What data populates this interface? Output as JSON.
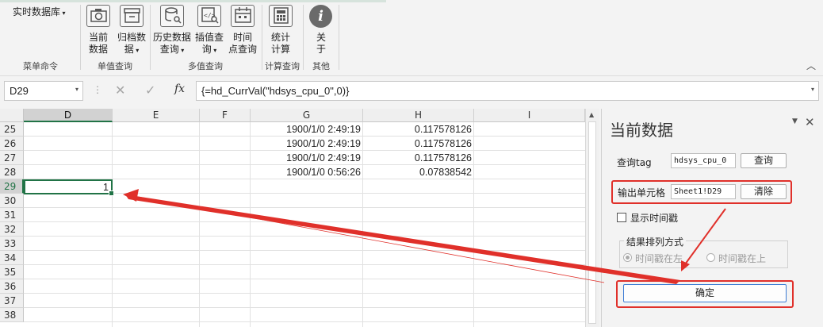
{
  "ribbon": {
    "menu_label": "实时数据库",
    "buttons": {
      "current": [
        "当前",
        "数据"
      ],
      "archive": [
        "归档数",
        "据"
      ],
      "history": [
        "历史数据",
        "查询"
      ],
      "interp": [
        "插值查",
        "询"
      ],
      "timepoint": [
        "时间",
        "点查询"
      ],
      "stats": [
        "统计",
        "计算"
      ],
      "about": [
        "关",
        "于"
      ]
    },
    "groups": {
      "menu": "菜单命令",
      "single": "单值查询",
      "multi": "多值查询",
      "calc": "计算查询",
      "other": "其他"
    }
  },
  "formula_bar": {
    "name_box": "D29",
    "fx": "fx",
    "formula": "{=hd_CurrVal(\"hdsys_cpu_0\",0)}"
  },
  "sheet": {
    "columns": [
      "D",
      "E",
      "F",
      "G",
      "H",
      "I"
    ],
    "rows": [
      "25",
      "26",
      "27",
      "28",
      "29",
      "30",
      "31",
      "32",
      "33",
      "34",
      "35",
      "36",
      "37",
      "38"
    ],
    "g_values": [
      "1900/1/0 2:49:19",
      "1900/1/0 2:49:19",
      "1900/1/0 2:49:19",
      "1900/1/0 0:56:26"
    ],
    "h_values": [
      "0.117578126",
      "0.117578126",
      "0.117578126",
      "0.07838542"
    ],
    "d29_value": "1"
  },
  "panel": {
    "title": "当前数据",
    "tag_label": "查询tag",
    "tag_value": "hdsys_cpu_0",
    "query_button": "查询",
    "output_label": "输出单元格",
    "output_value": "Sheet1!D29",
    "clear_button": "清除",
    "show_timestamp": "显示时间戳",
    "sort_group": "结果排列方式",
    "sort_left": "时间戳在左",
    "sort_top": "时间戳在上",
    "ok_button": "确定"
  },
  "colors": {
    "highlight": "#e0302a",
    "selection": "#217346"
  }
}
